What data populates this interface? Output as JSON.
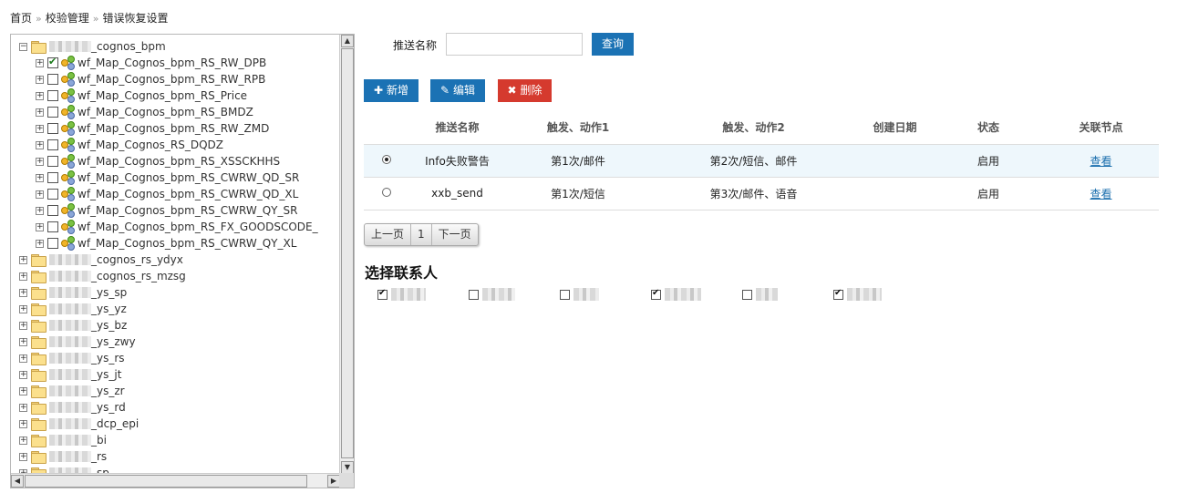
{
  "breadcrumb": {
    "items": [
      "首页",
      "校验管理",
      "错误恢复设置"
    ],
    "separator": "»"
  },
  "tree": {
    "root": {
      "label": "_cognos_bpm",
      "expanded": true
    },
    "children": [
      {
        "label": "wf_Map_Cognos_bpm_RS_RW_DPB",
        "checked": true
      },
      {
        "label": "wf_Map_Cognos_bpm_RS_RW_RPB",
        "checked": false
      },
      {
        "label": "wf_Map_Cognos_bpm_RS_Price",
        "checked": false
      },
      {
        "label": "wf_Map_Cognos_bpm_RS_BMDZ",
        "checked": false
      },
      {
        "label": "wf_Map_Cognos_bpm_RS_RW_ZMD",
        "checked": false
      },
      {
        "label": "wf_Map_Cognos_RS_DQDZ",
        "checked": false
      },
      {
        "label": "wf_Map_Cognos_bpm_RS_XSSCKHHS",
        "checked": false
      },
      {
        "label": "wf_Map_Cognos_bpm_RS_CWRW_QD_SR",
        "checked": false
      },
      {
        "label": "wf_Map_Cognos_bpm_RS_CWRW_QD_XL",
        "checked": false
      },
      {
        "label": "wf_Map_Cognos_bpm_RS_CWRW_QY_SR",
        "checked": false
      },
      {
        "label": "wf_Map_Cognos_bpm_RS_FX_GOODSCODE_",
        "checked": false
      },
      {
        "label": "wf_Map_Cognos_bpm_RS_CWRW_QY_XL",
        "checked": false
      }
    ],
    "folders": [
      {
        "label": "_cognos_rs_ydyx"
      },
      {
        "label": "_cognos_rs_mzsg"
      },
      {
        "label": "_ys_sp"
      },
      {
        "label": "_ys_yz"
      },
      {
        "label": "_ys_bz"
      },
      {
        "label": "_ys_zwy"
      },
      {
        "label": "_ys_rs"
      },
      {
        "label": "_ys_jt"
      },
      {
        "label": "_ys_zr"
      },
      {
        "label": "_ys_rd"
      },
      {
        "label": "_dcp_epi"
      },
      {
        "label": "_bi"
      },
      {
        "label": "_rs"
      },
      {
        "label": "_sp"
      }
    ]
  },
  "search": {
    "label": "推送名称",
    "value": "",
    "placeholder": "",
    "button": "查询"
  },
  "toolbar": {
    "add": "新增",
    "edit": "编辑",
    "delete": "删除"
  },
  "table": {
    "headers": [
      "",
      "推送名称",
      "触发、动作1",
      "触发、动作2",
      "创建日期",
      "状态",
      "关联节点"
    ],
    "rows": [
      {
        "selected": true,
        "name": "Info失败警告",
        "action1": "第1次/邮件",
        "action2": "第2次/短信、邮件",
        "created": "",
        "status": "启用",
        "link": "查看"
      },
      {
        "selected": false,
        "name": "xxb_send",
        "action1": "第1次/短信",
        "action2": "第3次/邮件、语音",
        "created": "",
        "status": "启用",
        "link": "查看"
      }
    ]
  },
  "pager": {
    "prev": "上一页",
    "page": "1",
    "next": "下一页"
  },
  "contacts": {
    "title": "选择联系人",
    "items": [
      {
        "checked": true
      },
      {
        "checked": false
      },
      {
        "checked": false
      },
      {
        "checked": true
      },
      {
        "checked": false
      },
      {
        "checked": true
      }
    ]
  },
  "colors": {
    "primary": "#1b72b4",
    "danger": "#d53a2e",
    "selected_row": "#eef7fc"
  }
}
